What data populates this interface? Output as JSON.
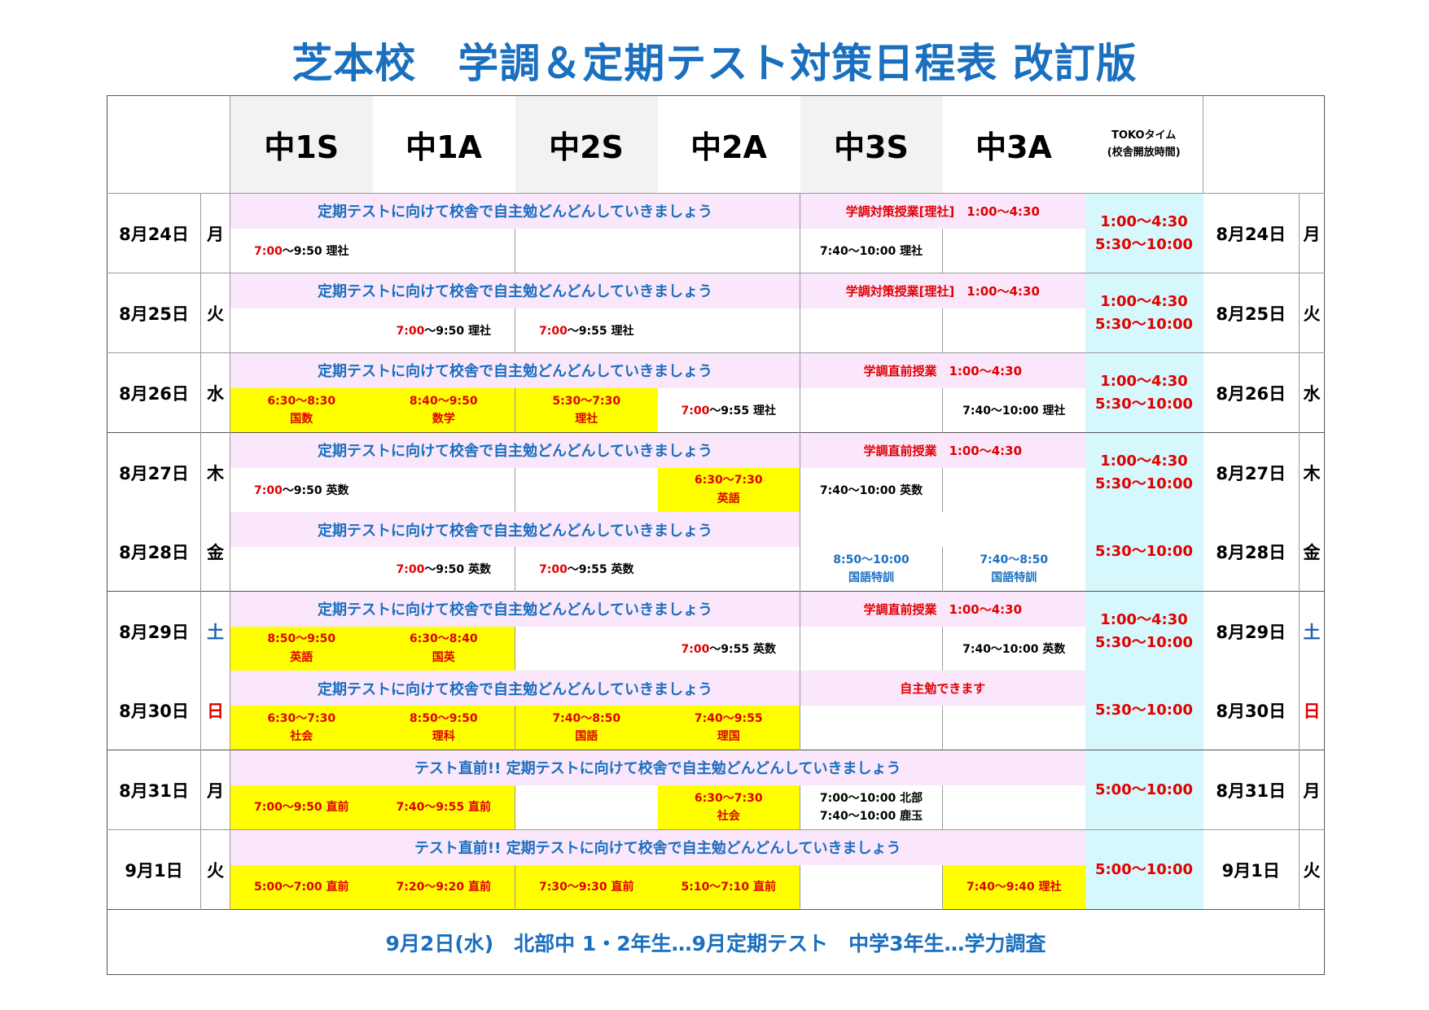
{
  "title": "芝本校　学調＆定期テスト対策日程表 改訂版",
  "headers": [
    "中1S",
    "中1A",
    "中2S",
    "中2A",
    "中3S",
    "中3A"
  ],
  "toko_line1": "TOKOタイム",
  "toko_line2": "(校舎開放時間)",
  "banner": "定期テストに向けて校舎で自主勉どんどんしていきましょう",
  "banner_final": "テスト直前!!  定期テストに向けて校舎で自主勉どんどんしていきましょう",
  "rows": [
    {
      "date": "8月24日",
      "dow": "月",
      "right": "学調対策授業[理社]　1:00～4:30",
      "toko1": "1:00～4:30",
      "toko2": "5:30～10:00",
      "c1a": "7:00",
      "c1b": "～9:50 理社",
      "c5": "7:40～10:00 理社"
    },
    {
      "date": "8月25日",
      "dow": "火",
      "right": "学調対策授業[理社]　1:00～4:30",
      "toko1": "1:00～4:30",
      "toko2": "5:30～10:00",
      "c2a": "7:00",
      "c2b": "～9:50 理社",
      "c3a": "7:00",
      "c3b": "～9:55 理社"
    },
    {
      "date": "8月26日",
      "dow": "水",
      "right": "学調直前授業　1:00～4:30",
      "toko1": "1:00～4:30",
      "toko2": "5:30～10:00",
      "y1a": "6:30～8:30",
      "y1b": "国数",
      "y2a": "8:40～9:50",
      "y2b": "数学",
      "y3a": "5:30～7:30",
      "y3b": "理社",
      "c4a": "7:00",
      "c4b": "～9:55 理社",
      "c6": "7:40～10:00 理社"
    },
    {
      "date": "8月27日",
      "dow": "木",
      "right": "学調直前授業　1:00～4:30",
      "toko1": "1:00～4:30",
      "toko2": "5:30～10:00",
      "c1a": "7:00",
      "c1b": "～9:50 英数",
      "y4a": "6:30～7:30",
      "y4b": "英語",
      "c5": "7:40～10:00 英数"
    },
    {
      "date": "8月28日",
      "dow": "金",
      "toko2": "5:30～10:00",
      "c2a": "7:00",
      "c2b": "～9:50 英数",
      "c3a": "7:00",
      "c3b": "～9:55 英数",
      "b5a": "8:50～10:00",
      "b5b": "国語特訓",
      "b6a": "7:40～8:50",
      "b6b": "国語特訓"
    },
    {
      "date": "8月29日",
      "dow": "土",
      "right": "学調直前授業　1:00～4:30",
      "toko1": "1:00～4:30",
      "toko2": "5:30～10:00",
      "y1a": "8:50～9:50",
      "y1b": "英語",
      "y2a": "6:30～8:40",
      "y2b": "国英",
      "c4a": "7:00",
      "c4b": "～9:55 英数",
      "c6": "7:40～10:00 英数"
    },
    {
      "date": "8月30日",
      "dow": "日",
      "right": "自主勉できます",
      "toko2": "5:30～10:00",
      "y1a": "6:30～7:30",
      "y1b": "社会",
      "y2a": "8:50～9:50",
      "y2b": "理科",
      "y3a": "7:40～8:50",
      "y3b": "国語",
      "y4a": "7:40～9:55",
      "y4b": "理国"
    },
    {
      "date": "8月31日",
      "dow": "月",
      "toko2": "5:00～10:00",
      "y1a": "7:00～9:50 直前",
      "y2a": "7:40～9:55 直前",
      "y4a": "6:30～7:30",
      "y4b": "社会",
      "c5a": "7:00～10:00 北部",
      "c5b": "7:40～10:00 鹿玉"
    },
    {
      "date": "9月1日",
      "dow": "火",
      "toko2": "5:00～10:00",
      "y1a": "5:00～7:00 直前",
      "y2a": "7:20～9:20 直前",
      "y3a": "7:30～9:30 直前",
      "y4a": "5:10～7:10 直前",
      "y6a": "7:40～9:40 理社"
    }
  ],
  "footer": "9月2日(水)　北部中 1・2年生…9月定期テスト　中学3年生…学力調査",
  "colors": {
    "title": "#1a6fbf",
    "pink": "#fbe7fb",
    "cyan": "#d6f7fb",
    "yellow": "#ffff00",
    "red": "#e00000",
    "saturday": "#1a5fb4",
    "sunday": "#e00000"
  }
}
